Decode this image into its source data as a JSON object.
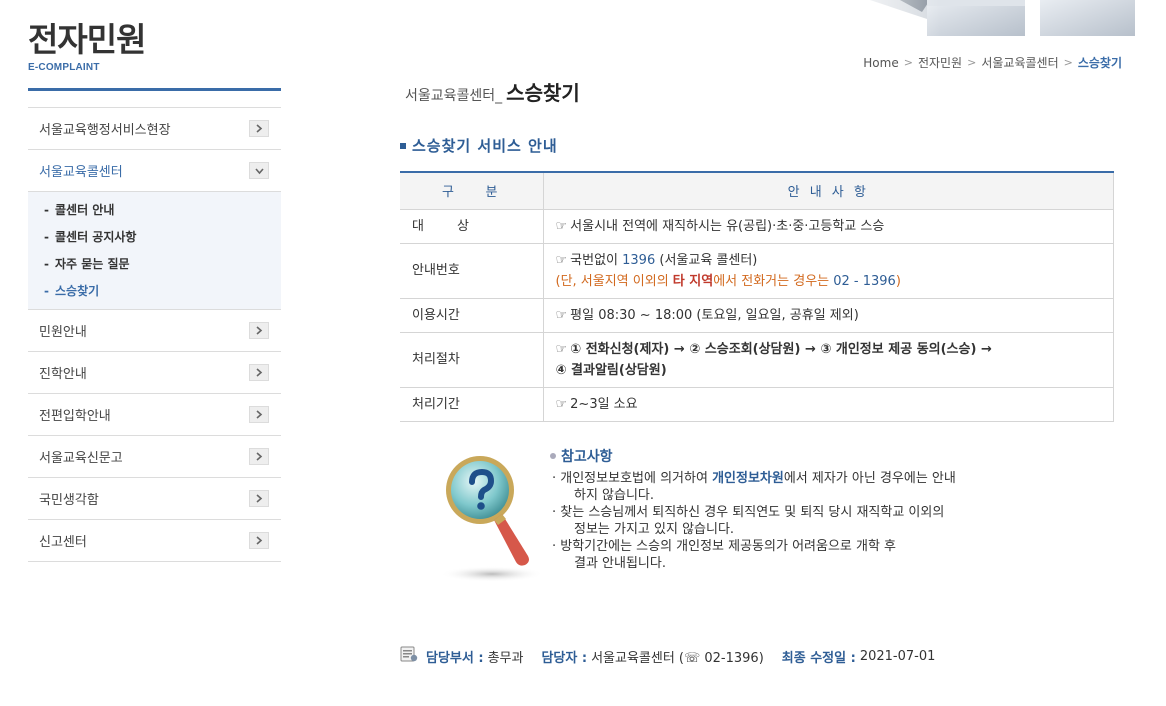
{
  "sidebar": {
    "title": "전자민원",
    "subtitle": "E-COMPLAINT",
    "items": [
      {
        "label": "서울교육행정서비스현장",
        "active": false
      },
      {
        "label": "서울교육콜센터",
        "active": true
      },
      {
        "label": "민원안내",
        "active": false
      },
      {
        "label": "진학안내",
        "active": false
      },
      {
        "label": "전편입학안내",
        "active": false
      },
      {
        "label": "서울교육신문고",
        "active": false
      },
      {
        "label": "국민생각함",
        "active": false
      },
      {
        "label": "신고센터",
        "active": false
      }
    ],
    "submenu": [
      {
        "label": "콜센터 안내"
      },
      {
        "label": "콜센터 공지사항"
      },
      {
        "label": "자주 묻는 질문"
      },
      {
        "label": "스승찾기"
      }
    ],
    "dash": "-"
  },
  "breadcrumb": {
    "items": [
      "Home",
      "전자민원",
      "서울교육콜센터",
      "스승찾기"
    ],
    "separator": ">"
  },
  "page": {
    "title_prefix": "서울교육콜센터_",
    "title_main": "스승찾기",
    "section_title": "스승찾기 서비스 안내"
  },
  "table": {
    "headers": [
      "구    분",
      "안 내 사 항"
    ],
    "hand": "☞",
    "rows": [
      {
        "label": "대        상",
        "text": "서울시내 전역에 재직하시는 유(공립)·초·중·고등학교 스승"
      },
      {
        "label": "안내번호",
        "line1_pre": "국번없이 ",
        "line1_num": "1396",
        "line1_post": " (서울교육 콜센터)",
        "line2_open": "(",
        "line2_a": "단, 서울지역 이외의 ",
        "line2_b": "타 지역",
        "line2_c": "에서 전화거는 경우는 ",
        "line2_d": "02 - 1396",
        "line2_close": ")"
      },
      {
        "label": "이용시간",
        "text": "평일 08:30 ~ 18:00 (토요일, 일요일, 공휴일 제외)"
      },
      {
        "label": "처리절차",
        "line1": "① 전화신청(제자) → ② 스승조회(상담원) → ③ 개인정보 제공 동의(스승) →",
        "line2": "④ 결과알림(상담원)"
      },
      {
        "label": "처리기간",
        "text": "2~3일 소요"
      }
    ]
  },
  "reference": {
    "title": "참고사항",
    "items": [
      {
        "pre": "· 개인정보보호법에 의거하여 ",
        "bold": "개인정보차원",
        "post": "에서 제자가 아닌 경우에는 안내",
        "cont": "하지 않습니다."
      },
      {
        "pre": "· 찾는 스승님께서 퇴직하신 경우 퇴직연도 및 퇴직 당시 재직학교 이외의",
        "bold": "",
        "post": "",
        "cont": "정보는 가지고 있지 않습니다."
      },
      {
        "pre": "· 방학기간에는 스승의 개인정보 제공동의가 어려움으로 개학 후",
        "bold": "",
        "post": "",
        "cont": "결과 안내됩니다."
      }
    ]
  },
  "footer": {
    "dept_label": "담당부서 :",
    "dept_value": "총무과",
    "person_label": "담당자 :",
    "person_value": "서울교육콜센터 (☏ 02-1396)",
    "updated_label": "최종 수정일 :",
    "updated_value": "2021-07-01"
  },
  "colors": {
    "accent": "#3a6ca8",
    "section": "#2e5d95",
    "warning": "#d2691e",
    "emphasis": "#c0392b"
  }
}
